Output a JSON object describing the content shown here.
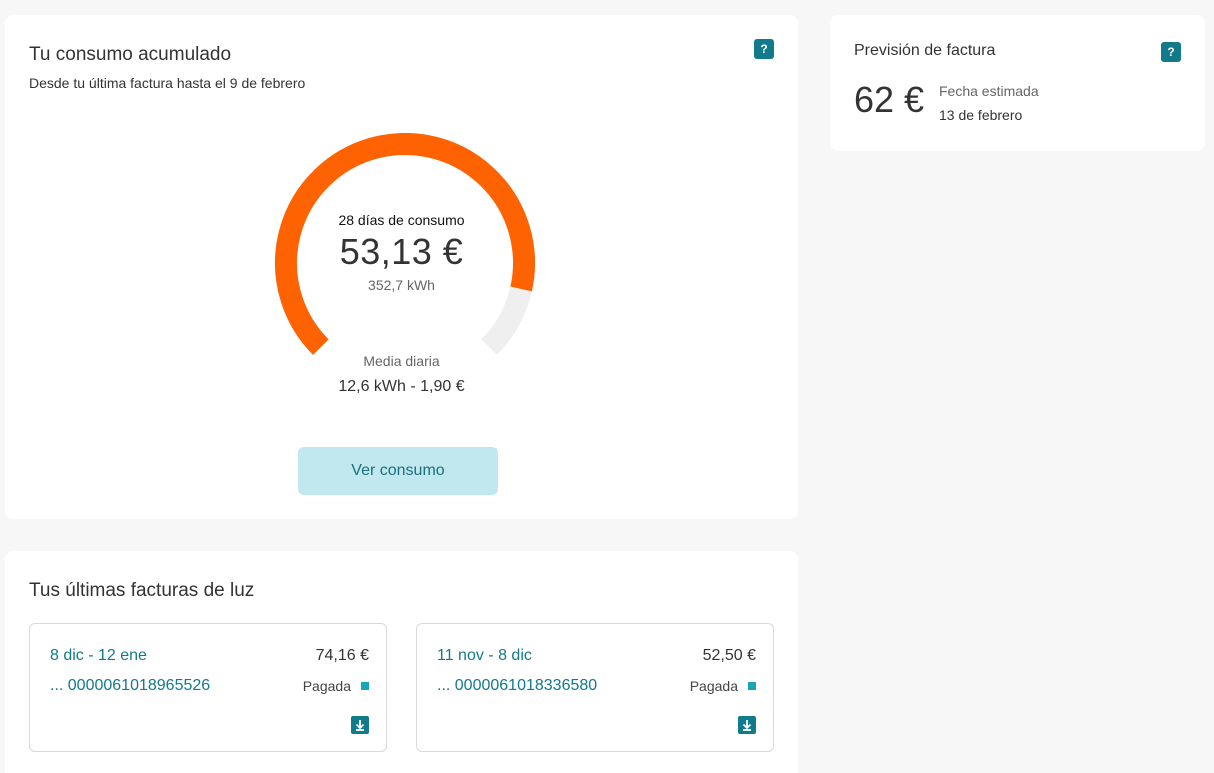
{
  "consumo": {
    "title": "Tu consumo acumulado",
    "subtitle": "Desde tu última factura hasta el 9 de febrero",
    "help_label": "?",
    "days_label": "28 días de consumo",
    "amount": "53,13 €",
    "kwh": "352,7 kWh",
    "daily_label": "Media diaria",
    "daily_value": "12,6 kWh - 1,90 €",
    "button_label": "Ver consumo",
    "gauge": {
      "progress": 0.88,
      "fill_color": "#ff6200",
      "track_color": "#efefef"
    }
  },
  "prevision": {
    "title": "Previsión de factura",
    "help_label": "?",
    "amount": "62 €",
    "date_label": "Fecha estimada",
    "date_value": "13 de febrero"
  },
  "facturas": {
    "title": "Tus últimas facturas de luz",
    "items": [
      {
        "period": "8 dic - 12 ene",
        "amount": "74,16 €",
        "number": "... 0000061018965526",
        "status": "Pagada"
      },
      {
        "period": "11 nov - 8 dic",
        "amount": "52,50 €",
        "number": "... 0000061018336580",
        "status": "Pagada"
      }
    ]
  },
  "colors": {
    "accent": "#117a8b",
    "link": "#117a8b",
    "status_dot": "#19a6b8"
  },
  "icons": {
    "help": "question-icon",
    "download": "download-icon"
  }
}
